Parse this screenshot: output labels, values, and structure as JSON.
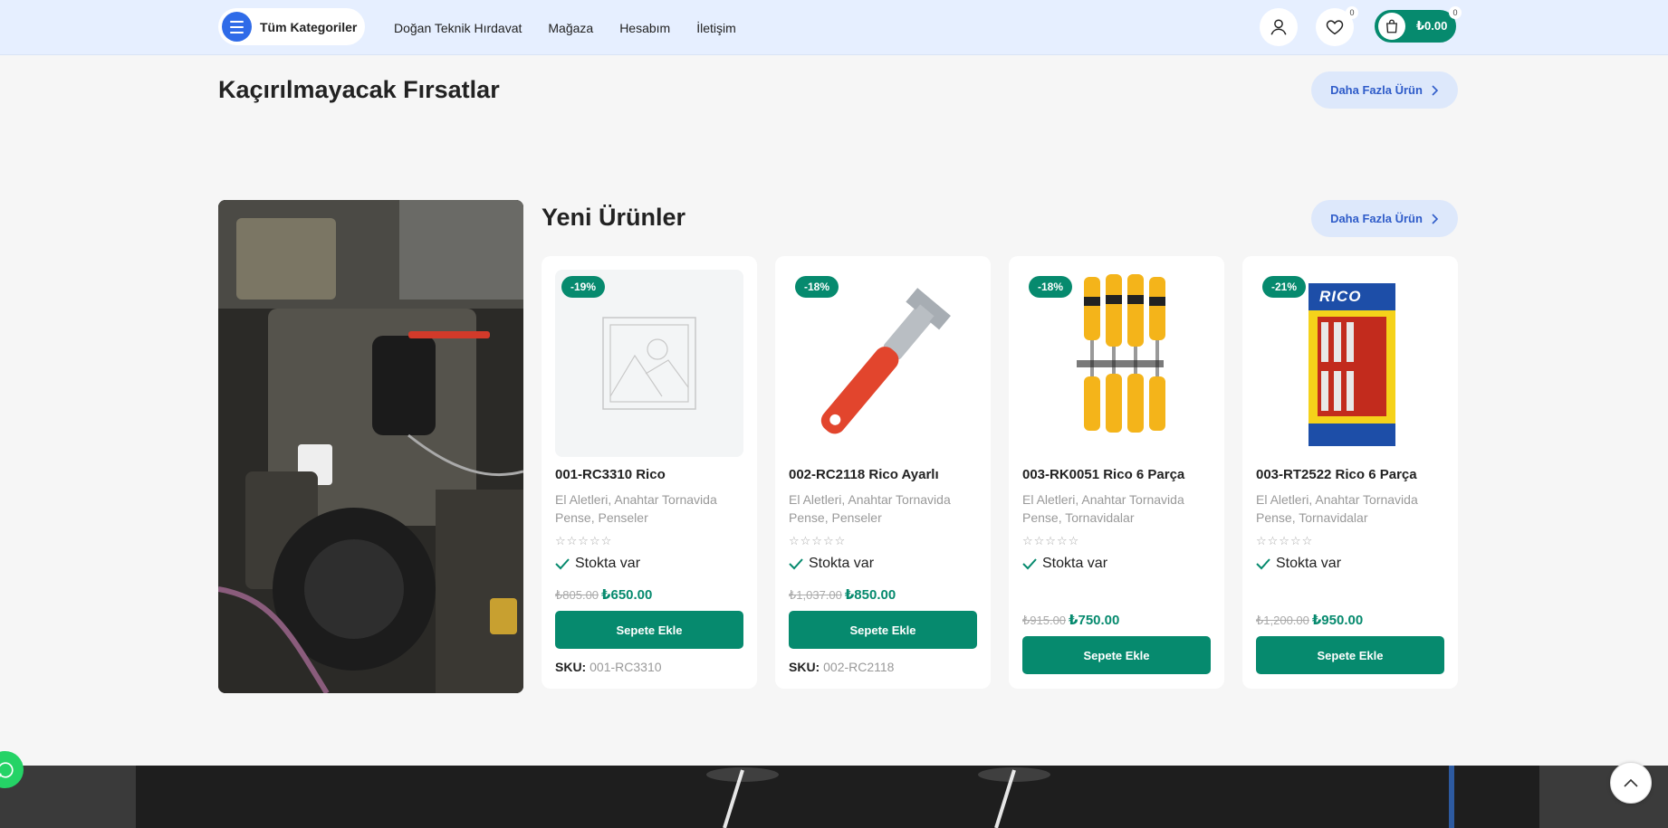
{
  "header": {
    "categories_label": "Tüm Kategoriler",
    "nav": [
      "Doğan Teknik Hırdavat",
      "Mağaza",
      "Hesabım",
      "İletişim"
    ],
    "wishlist_count": "0",
    "cart_count": "0",
    "cart_total": "₺0.00"
  },
  "deals": {
    "title": "Kaçırılmayacak Fırsatlar",
    "more_label": "Daha Fazla Ürün"
  },
  "new_products": {
    "title": "Yeni Ürünler",
    "more_label": "Daha Fazla Ürün",
    "items": [
      {
        "discount": "-19%",
        "name": "001-RC3310 Rico",
        "categories": "El Aletleri, Anahtar Tornavida Pense, Penseler",
        "stars": "☆☆☆☆☆",
        "stock": "Stokta var",
        "old_price": "₺805.00",
        "price": "₺650.00",
        "add_label": "Sepete Ekle",
        "sku_label": "SKU:",
        "sku": "001-RC3310"
      },
      {
        "discount": "-18%",
        "name": "002-RC2118 Rico Ayarlı",
        "categories": "El Aletleri, Anahtar Tornavida Pense, Penseler",
        "stars": "☆☆☆☆☆",
        "stock": "Stokta var",
        "old_price": "₺1,037.00",
        "price": "₺850.00",
        "add_label": "Sepete Ekle",
        "sku_label": "SKU:",
        "sku": "002-RC2118"
      },
      {
        "discount": "-18%",
        "name": "003-RK0051 Rico 6 Parça",
        "categories": "El Aletleri, Anahtar Tornavida Pense, Tornavidalar",
        "stars": "☆☆☆☆☆",
        "stock": "Stokta var",
        "old_price": "₺915.00",
        "price": "₺750.00",
        "add_label": "Sepete Ekle"
      },
      {
        "discount": "-21%",
        "name": "003-RT2522 Rico 6 Parça",
        "categories": "El Aletleri, Anahtar Tornavida Pense, Tornavidalar",
        "stars": "☆☆☆☆☆",
        "stock": "Stokta var",
        "old_price": "₺1,200.00",
        "price": "₺950.00",
        "add_label": "Sepete Ekle",
        "box_brand": "RICO"
      }
    ]
  },
  "colors": {
    "accent": "#068a6e",
    "header_bg": "#e6efff",
    "button_blue": "#2f6be8"
  }
}
